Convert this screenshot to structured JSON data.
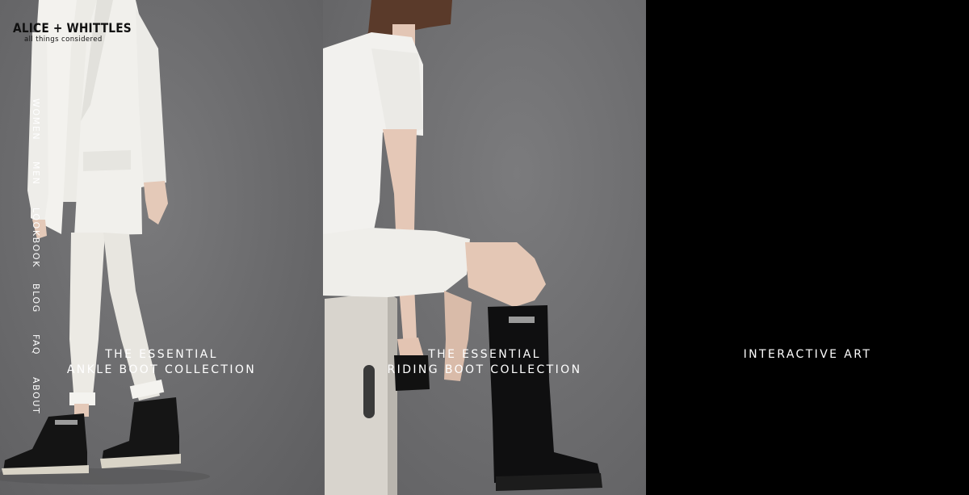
{
  "brand": {
    "name": "ALICE + WHITTLES",
    "tagline": "all things considered"
  },
  "nav": {
    "items": [
      {
        "label": "WOMEN"
      },
      {
        "label": "MEN"
      },
      {
        "label": "LOOKBOOK"
      },
      {
        "label": "BLOG"
      },
      {
        "label": "FAQ"
      },
      {
        "label": "ABOUT"
      }
    ]
  },
  "panels": [
    {
      "line1": "THE ESSENTIAL",
      "line2": "ANKLE BOOT COLLECTION"
    },
    {
      "line1": "THE ESSENTIAL",
      "line2": "RIDING BOOT COLLECTION"
    },
    {
      "line1": "INTERACTIVE ART"
    }
  ],
  "colors": {
    "text_light": "#ffffff",
    "text_dark": "#111111",
    "backdrop_grey": "#6c6c6e",
    "art_panel": "#000000"
  }
}
